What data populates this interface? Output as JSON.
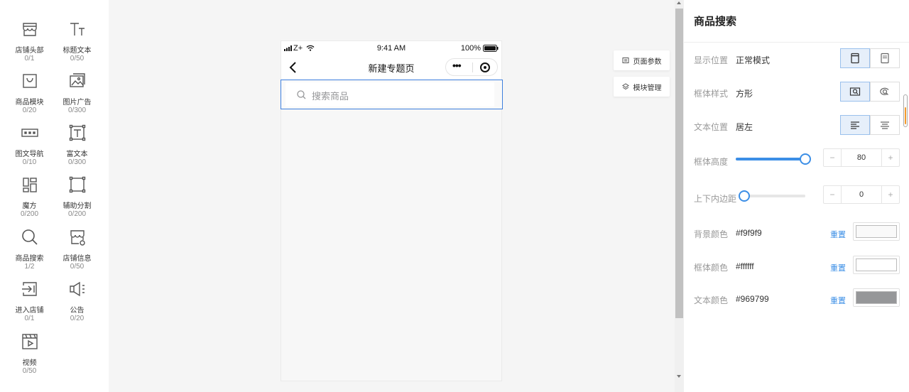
{
  "palette": {
    "items": [
      {
        "name": "店铺头部",
        "count": "0/1",
        "icon": "shop-header-icon"
      },
      {
        "name": "标题文本",
        "count": "0/50",
        "icon": "title-text-icon"
      },
      {
        "name": "商品模块",
        "count": "0/20",
        "icon": "goods-module-icon"
      },
      {
        "name": "图片广告",
        "count": "0/300",
        "icon": "image-ad-icon"
      },
      {
        "name": "图文导航",
        "count": "0/10",
        "icon": "image-text-nav-icon"
      },
      {
        "name": "富文本",
        "count": "0/300",
        "icon": "rich-text-icon"
      },
      {
        "name": "魔方",
        "count": "0/200",
        "icon": "magic-cube-icon"
      },
      {
        "name": "辅助分割",
        "count": "0/200",
        "icon": "divider-icon"
      },
      {
        "name": "商品搜索",
        "count": "1/2",
        "icon": "search-icon"
      },
      {
        "name": "店铺信息",
        "count": "0/50",
        "icon": "shop-info-icon"
      },
      {
        "name": "进入店铺",
        "count": "0/1",
        "icon": "enter-shop-icon"
      },
      {
        "name": "公告",
        "count": "0/20",
        "icon": "notice-icon"
      },
      {
        "name": "视频",
        "count": "0/50",
        "icon": "video-icon"
      }
    ]
  },
  "phone": {
    "status": {
      "carrier": "Z+",
      "time": "9:41 AM",
      "battery": "100%"
    },
    "nav_title": "新建专题页",
    "search": {
      "placeholder": "搜索商品"
    }
  },
  "side_buttons": {
    "page_params": "页面参数",
    "module_manage": "模块管理"
  },
  "panel": {
    "title": "商品搜索",
    "display_position": {
      "label": "显示位置",
      "value": "正常模式"
    },
    "frame_style": {
      "label": "框体样式",
      "value": "方形"
    },
    "text_position": {
      "label": "文本位置",
      "value": "居左"
    },
    "frame_height": {
      "label": "框体高度",
      "value": "80",
      "fraction": 1.0
    },
    "padding": {
      "label": "上下内边距",
      "value": "0",
      "fraction": 0.0
    },
    "bg_color": {
      "label": "背景颜色",
      "value": "#f9f9f9",
      "color": "#f9f9f9"
    },
    "frame_color": {
      "label": "框体颜色",
      "value": "#ffffff",
      "color": "#ffffff"
    },
    "text_color": {
      "label": "文本颜色",
      "value": "#969799",
      "color": "#969799"
    },
    "reset_label": "重置",
    "stepper_minus": "−",
    "stepper_plus": "+"
  },
  "colors": {
    "accent": "#3b8ee6",
    "selected_border": "#3d7fde"
  }
}
